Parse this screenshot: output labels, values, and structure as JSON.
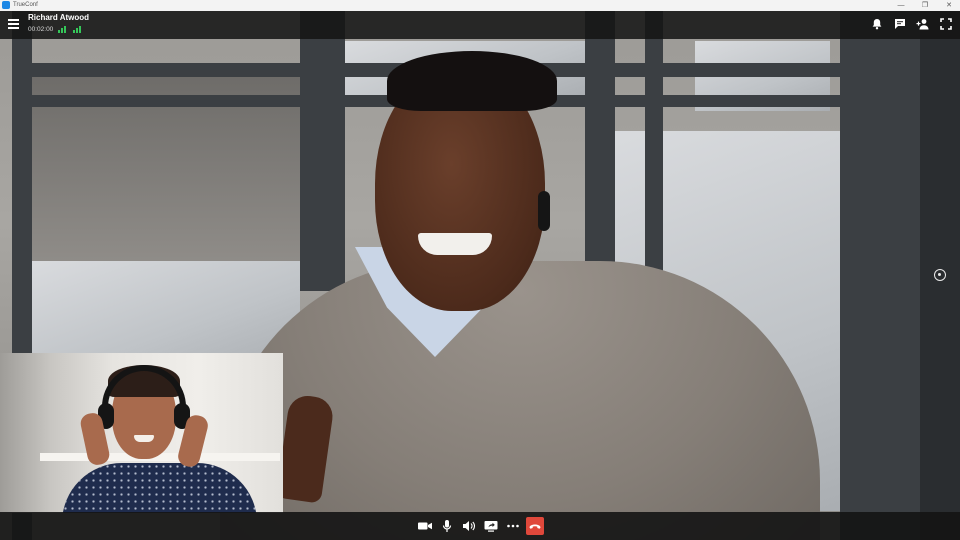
{
  "window": {
    "app_title": "TrueConf",
    "controls": {
      "minimize": "—",
      "maximize": "❐",
      "close": "✕"
    }
  },
  "call": {
    "participant_name": "Richard Atwood",
    "duration": "00:02:00"
  },
  "top_bar": {
    "icons": [
      "menu-icon",
      "signal-send-icon",
      "signal-receive-icon",
      "bell-icon",
      "chat-icon",
      "add-participant-icon",
      "fullscreen-icon"
    ]
  },
  "bottom_bar": {
    "icons": [
      "camera-icon",
      "microphone-icon",
      "speaker-icon",
      "share-screen-icon",
      "more-icon",
      "hang-up-icon"
    ]
  },
  "colors": {
    "hangup": "#e0483b",
    "signal": "#35c759",
    "bar_bg": "#141414"
  }
}
